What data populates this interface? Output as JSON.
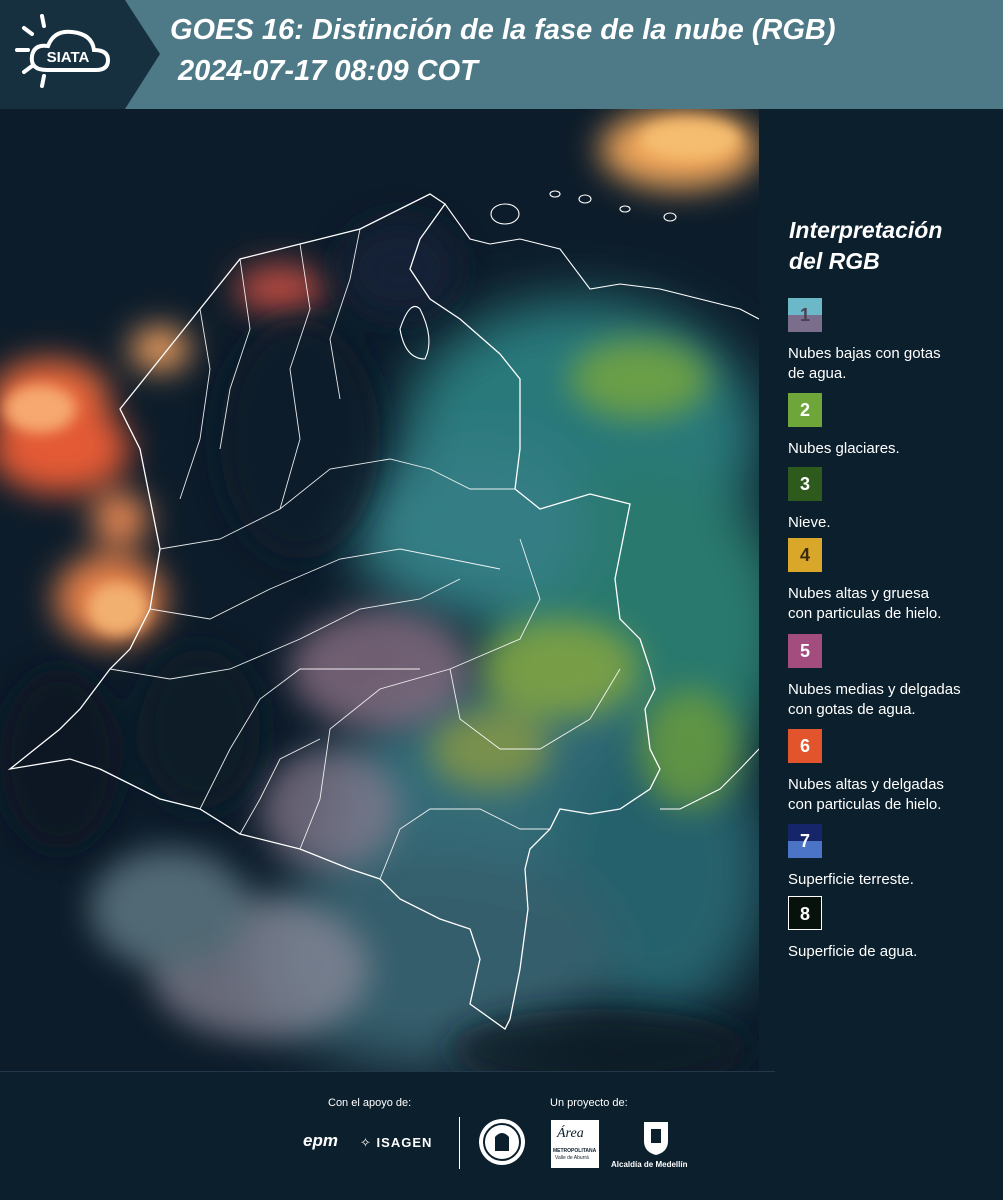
{
  "header": {
    "title_line1": "GOES 16: Distinción de la fase de la nube (RGB)",
    "title_line2": "2024-07-17 08:09 COT",
    "logo_text": "SIATA"
  },
  "legend": {
    "title_line1": "Interpretación",
    "title_line2": "del RGB",
    "items": [
      {
        "number": "1",
        "label_line1": "Nubes bajas con gotas",
        "label_line2": "de agua.",
        "color_top": "#6bb8c8",
        "color_bottom": "#7a6e8c"
      },
      {
        "number": "2",
        "label_line1": "Nubes glaciares.",
        "label_line2": "",
        "color_top": "#6ea63a",
        "color_bottom": "#6ea63a"
      },
      {
        "number": "3",
        "label_line1": "Nieve.",
        "label_line2": "",
        "color_top": "#2f5a1e",
        "color_bottom": "#2f5a1e"
      },
      {
        "number": "4",
        "label_line1": "Nubes altas y gruesa",
        "label_line2": "con particulas de hielo.",
        "color_top": "#d9a82a",
        "color_bottom": "#d9a82a"
      },
      {
        "number": "5",
        "label_line1": "Nubes medias y delgadas",
        "label_line2": "con gotas de agua.",
        "color_top": "#a24d7e",
        "color_bottom": "#a24d7e"
      },
      {
        "number": "6",
        "label_line1": "Nubes altas y delgadas",
        "label_line2": "con particulas de hielo.",
        "color_top": "#e2542c",
        "color_bottom": "#e2542c"
      },
      {
        "number": "7",
        "label_line1": "Superficie terreste.",
        "label_line2": "",
        "color_top": "#16246a",
        "color_bottom": "#4b74c6"
      },
      {
        "number": "8",
        "label_line1": "Superficie de agua.",
        "label_line2": "",
        "color_top": "#07120c",
        "color_bottom": "#07120c"
      }
    ]
  },
  "footer": {
    "support_caption": "Con el apoyo de:",
    "project_caption": "Un proyecto de:",
    "partner_epm": "epm",
    "partner_isagen": "ISAGEN",
    "partner_area_line1": "Área",
    "partner_area_line2": "METROPOLITANA",
    "partner_area_line3": "Valle de Aburrá",
    "partner_alcaldia": "Alcaldía de Medellín"
  },
  "colors": {
    "header_bg": "#4e7a88",
    "page_bg": "#0c1f2c",
    "border_white": "#ffffff"
  }
}
